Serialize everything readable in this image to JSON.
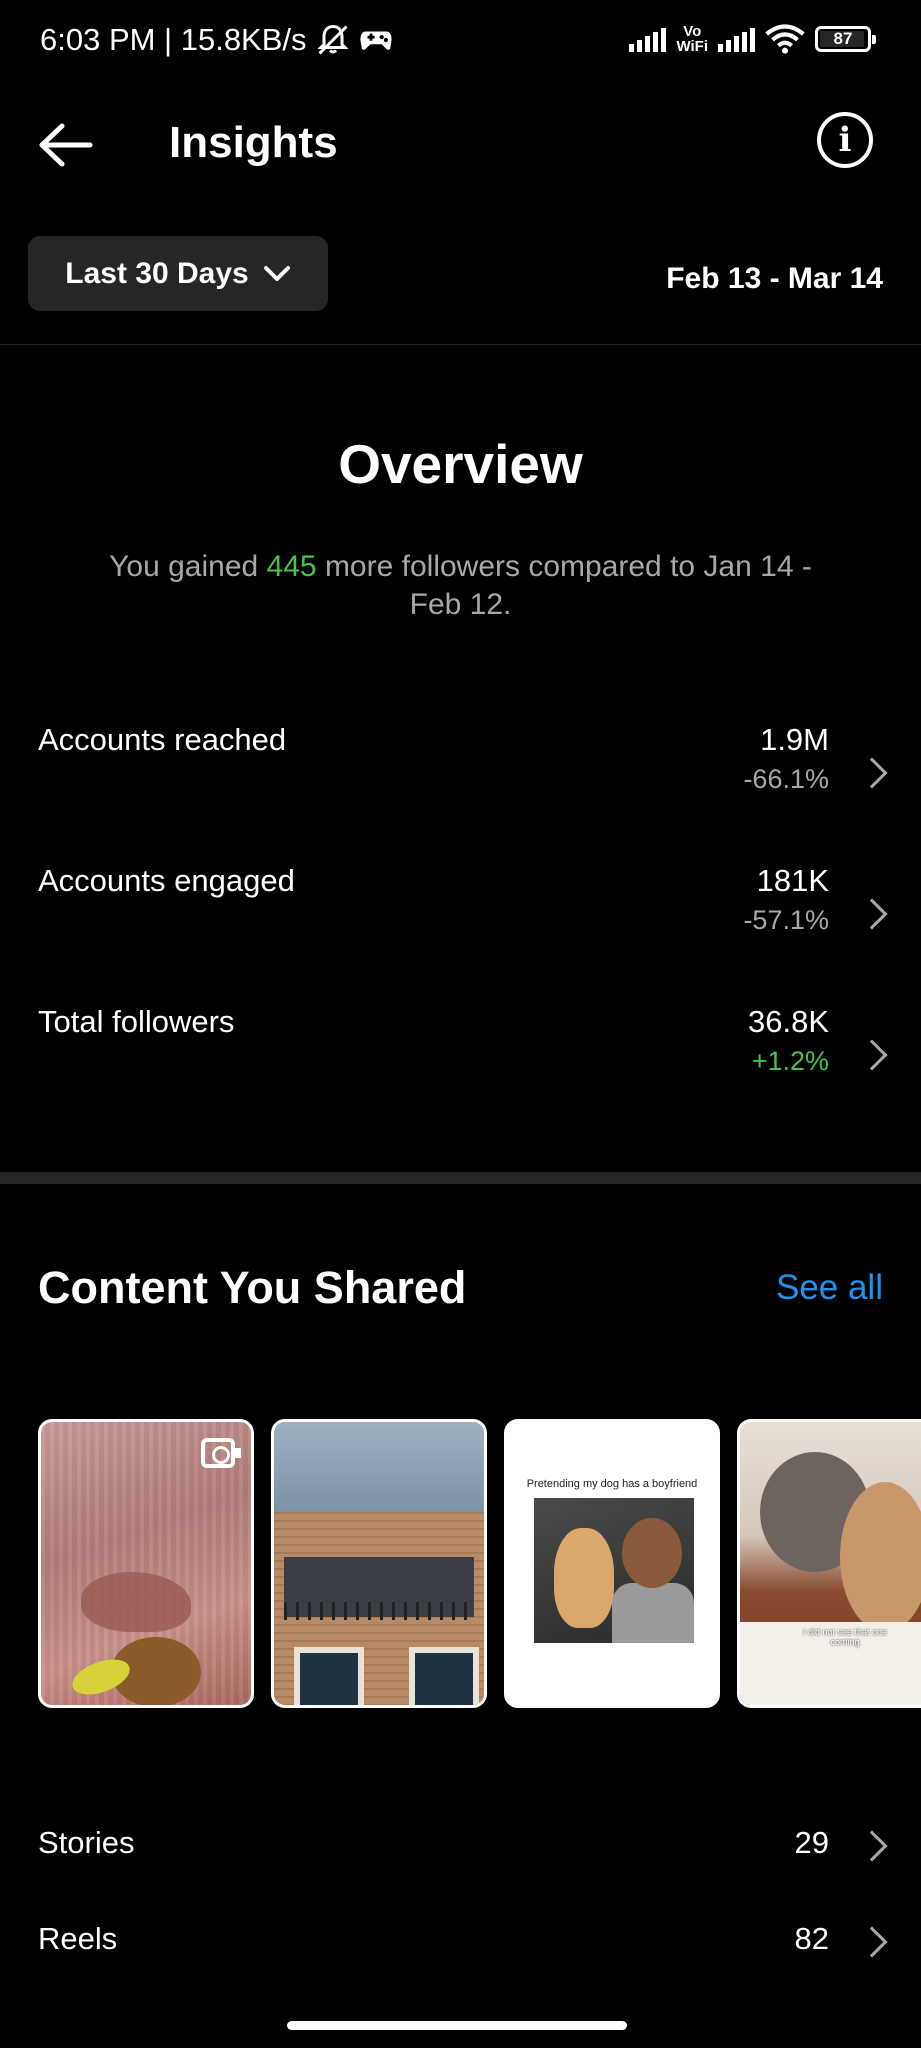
{
  "status_bar": {
    "time_speed": "6:03 PM | 15.8KB/s",
    "vowifi_top": "Vo",
    "vowifi_bottom": "WiFi",
    "battery": "87"
  },
  "header": {
    "title": "Insights"
  },
  "range": {
    "selector_label": "Last 30 Days",
    "dates": "Feb 13 - Mar 14"
  },
  "overview": {
    "title": "Overview",
    "sub_prefix": "You gained ",
    "sub_number": "445",
    "sub_suffix": " more followers compared to Jan 14 - Feb 12.",
    "metrics": [
      {
        "label": "Accounts reached",
        "value": "1.9M",
        "change": "-66.1%"
      },
      {
        "label": "Accounts engaged",
        "value": "181K",
        "change": "-57.1%"
      },
      {
        "label": "Total followers",
        "value": "36.8K",
        "change": "+1.2%"
      }
    ]
  },
  "content": {
    "title": "Content You Shared",
    "see_all": "See all",
    "thumb3_caption": "Pretending my dog has a boyfriend",
    "thumb4_caption": "I did not see that one coming",
    "rows": [
      {
        "label": "Stories",
        "value": "29"
      },
      {
        "label": "Reels",
        "value": "82"
      }
    ]
  },
  "colors": {
    "accent_link": "#1d93f0",
    "positive": "#4ac24a",
    "muted": "#a8a8a8"
  }
}
